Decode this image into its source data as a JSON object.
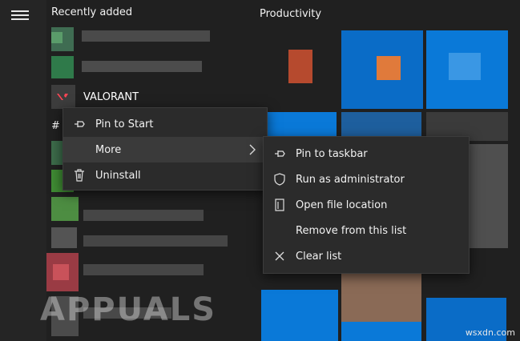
{
  "start": {
    "recently_added_label": "Recently added",
    "productivity_label": "Productivity",
    "app_name": "VALORANT",
    "hash_label": "#"
  },
  "context_menu": {
    "items": [
      {
        "label": "Pin to Start",
        "icon": "pin-icon"
      },
      {
        "label": "More",
        "icon": "",
        "has_submenu": true
      },
      {
        "label": "Uninstall",
        "icon": "trash-icon"
      }
    ]
  },
  "submenu": {
    "items": [
      {
        "label": "Pin to taskbar",
        "icon": "pin-icon"
      },
      {
        "label": "Run as administrator",
        "icon": "shield-icon"
      },
      {
        "label": "Open file location",
        "icon": "folder-icon"
      },
      {
        "label": "Remove from this list",
        "icon": ""
      },
      {
        "label": "Clear list",
        "icon": "close-icon"
      }
    ]
  },
  "watermark": {
    "brand": "APPUALS",
    "site": "wsxdn.com"
  },
  "colors": {
    "tile_blue": "#0a79d8",
    "menu_bg": "#2b2b2b",
    "valorant_red": "#ff4655"
  }
}
